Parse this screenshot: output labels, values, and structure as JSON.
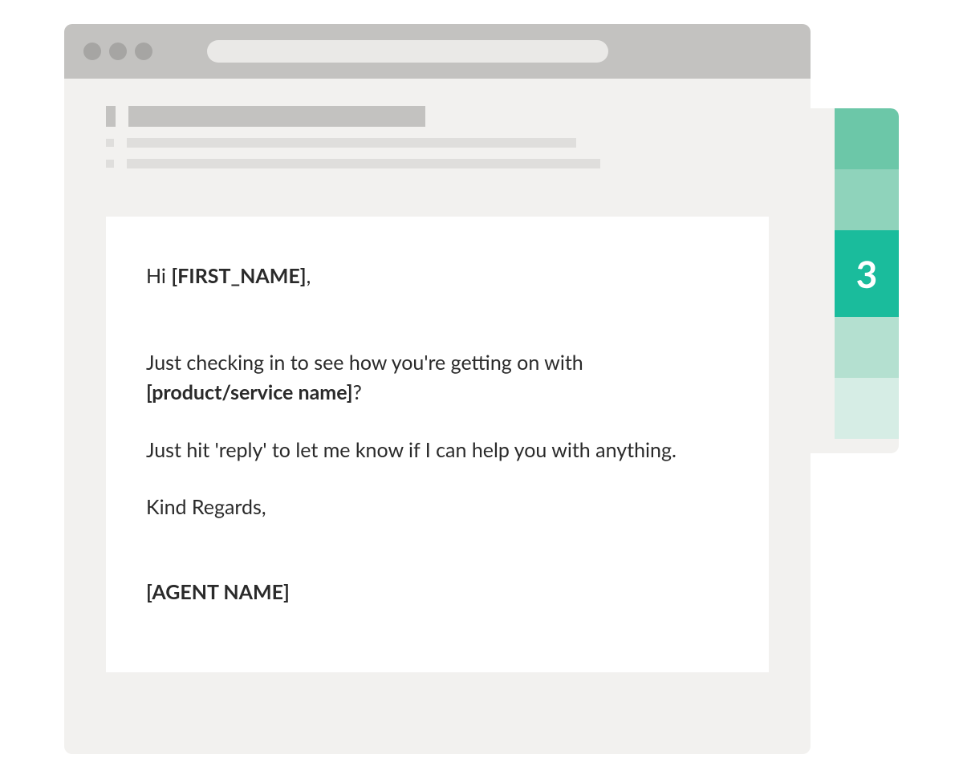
{
  "tabs": {
    "active_label": "3"
  },
  "email": {
    "greeting_prefix": "Hi ",
    "greeting_name": "[FIRST_NAME]",
    "greeting_suffix": ",",
    "line1_a": "Just checking in to see how you're getting on with ",
    "line1_b": "[product/service name]",
    "line1_c": "?",
    "line2": "Just hit 'reply' to let me know if I can help you with anything.",
    "signoff": "Kind Regards,",
    "agent": "[AGENT NAME]"
  }
}
